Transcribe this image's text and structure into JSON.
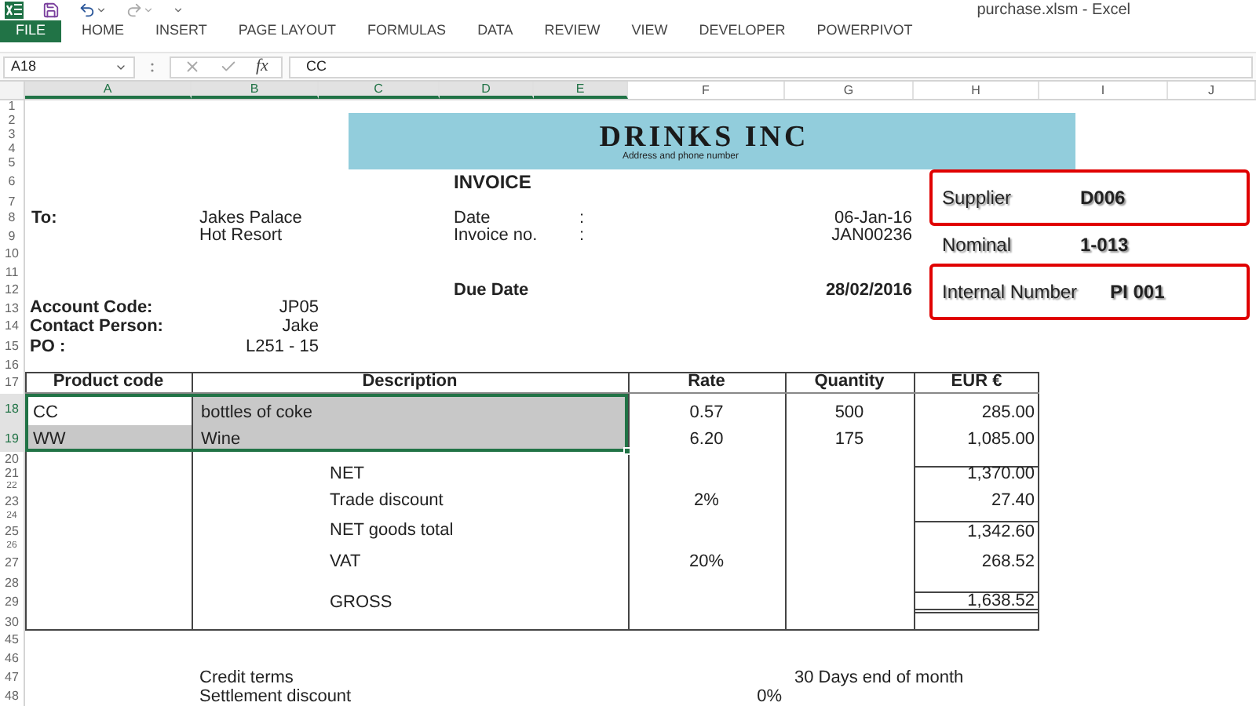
{
  "window": {
    "title": "purchase.xlsm - Excel"
  },
  "ribbon_tabs": [
    {
      "label": "FILE",
      "selected": true
    },
    {
      "label": "HOME",
      "selected": false
    },
    {
      "label": "INSERT",
      "selected": false
    },
    {
      "label": "PAGE LAYOUT",
      "selected": false
    },
    {
      "label": "FORMULAS",
      "selected": false
    },
    {
      "label": "DATA",
      "selected": false
    },
    {
      "label": "REVIEW",
      "selected": false
    },
    {
      "label": "VIEW",
      "selected": false
    },
    {
      "label": "DEVELOPER",
      "selected": false
    },
    {
      "label": "POWERPIVOT",
      "selected": false
    }
  ],
  "formula_bar": {
    "name_box": "A18",
    "function_label": "fx",
    "value": "CC"
  },
  "column_headers": [
    {
      "label": "A",
      "selected": true
    },
    {
      "label": "B",
      "selected": true
    },
    {
      "label": "C",
      "selected": true
    },
    {
      "label": "D",
      "selected": true
    },
    {
      "label": "E",
      "selected": true
    },
    {
      "label": "F",
      "selected": false
    },
    {
      "label": "G",
      "selected": false
    },
    {
      "label": "H",
      "selected": false
    },
    {
      "label": "I",
      "selected": false
    },
    {
      "label": "J",
      "selected": false
    }
  ],
  "row_numbers": [
    {
      "label": "1",
      "selected": false
    },
    {
      "label": "2",
      "selected": false
    },
    {
      "label": "3",
      "selected": false
    },
    {
      "label": "4",
      "selected": false
    },
    {
      "label": "5",
      "selected": false
    },
    {
      "label": "6",
      "selected": false
    },
    {
      "label": "7",
      "selected": false
    },
    {
      "label": "8",
      "selected": false
    },
    {
      "label": "9",
      "selected": false
    },
    {
      "label": "10",
      "selected": false
    },
    {
      "label": "11",
      "selected": false
    },
    {
      "label": "12",
      "selected": false
    },
    {
      "label": "13",
      "selected": false
    },
    {
      "label": "14",
      "selected": false
    },
    {
      "label": "15",
      "selected": false
    },
    {
      "label": "16",
      "selected": false
    },
    {
      "label": "17",
      "selected": false
    },
    {
      "label": "18",
      "selected": true
    },
    {
      "label": "19",
      "selected": true
    },
    {
      "label": "20",
      "selected": false
    },
    {
      "label": "21",
      "selected": false
    },
    {
      "label": "22",
      "selected": false
    },
    {
      "label": "23",
      "selected": false
    },
    {
      "label": "24",
      "selected": false
    },
    {
      "label": "25",
      "selected": false
    },
    {
      "label": "26",
      "selected": false
    },
    {
      "label": "27",
      "selected": false
    },
    {
      "label": "28",
      "selected": false
    },
    {
      "label": "29",
      "selected": false
    },
    {
      "label": "30",
      "selected": false
    },
    {
      "label": "45",
      "selected": false
    },
    {
      "label": "46",
      "selected": false
    },
    {
      "label": "47",
      "selected": false
    },
    {
      "label": "48",
      "selected": false
    }
  ],
  "banner": {
    "title": "DRINKS INC",
    "subtitle": "Address and phone number"
  },
  "invoice": {
    "heading": "INVOICE",
    "to_label": "To:",
    "to_lines": [
      "Jakes Palace",
      "Hot Resort"
    ],
    "fields": [
      {
        "label": "Date",
        "separator": ":",
        "value": "06-Jan-16"
      },
      {
        "label": "Invoice no.",
        "separator": ":",
        "value": "JAN00236"
      }
    ],
    "due_date": {
      "label": "Due Date",
      "value": "28/02/2016"
    },
    "customer": [
      {
        "label": "Account Code:",
        "value": "JP05"
      },
      {
        "label": "Contact Person:",
        "value": "Jake"
      },
      {
        "label": "PO :",
        "value": "L251 - 15"
      }
    ]
  },
  "supplier_panel": [
    {
      "label": "Supplier",
      "value": "D006",
      "highlighted": true
    },
    {
      "label": "Nominal",
      "value": "1-013",
      "highlighted": false
    },
    {
      "label": "Internal Number",
      "value": "PI 001",
      "highlighted": true
    }
  ],
  "table": {
    "columns": [
      "Product code",
      "Description",
      "Rate",
      "Quantity",
      "EUR €"
    ],
    "rows": [
      {
        "code": "CC",
        "description": "bottles of coke",
        "rate": "0.57",
        "quantity": "500",
        "amount": "285.00",
        "selected": true,
        "active": true
      },
      {
        "code": "WW",
        "description": "Wine",
        "rate": "6.20",
        "quantity": "175",
        "amount": "1,085.00",
        "selected": true,
        "active": false
      }
    ],
    "totals": [
      {
        "label": "NET",
        "amount": "1,370.00"
      },
      {
        "label": "Trade discount",
        "rate": "2%",
        "amount": "27.40"
      },
      {
        "label": "NET goods total",
        "amount": "1,342.60"
      },
      {
        "label": "VAT",
        "rate": "20%",
        "amount": "268.52"
      },
      {
        "label": "GROSS",
        "amount": "1,638.52"
      }
    ]
  },
  "terms": [
    {
      "label": "Credit terms",
      "value": "30 Days end of month"
    },
    {
      "label": "Settlement discount",
      "value": "0%"
    }
  ]
}
